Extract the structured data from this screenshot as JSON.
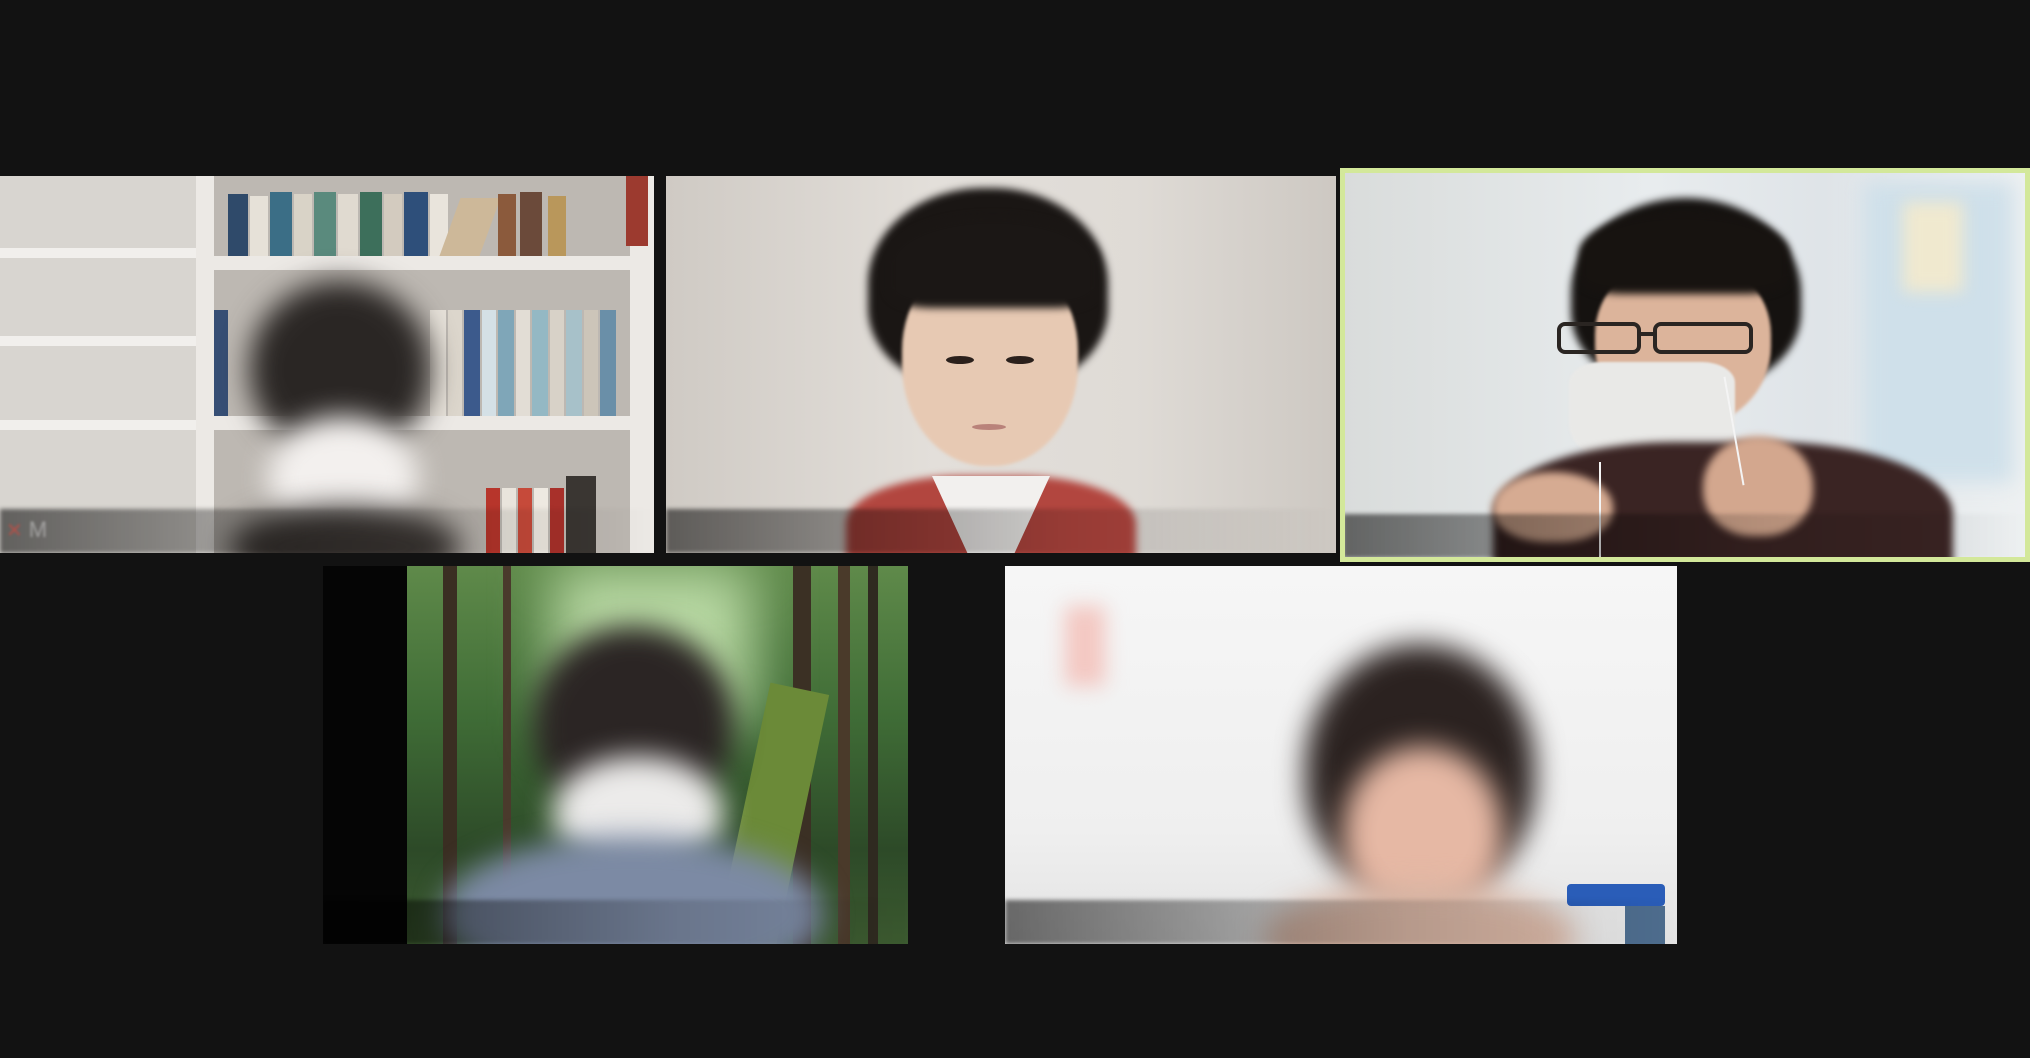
{
  "meeting": {
    "view": "gallery",
    "participant_count": 5,
    "active_speaker_index": 2
  },
  "participants": [
    {
      "name": "M",
      "muted": true,
      "video_on": true,
      "background": "bookshelf"
    },
    {
      "name": "",
      "muted": false,
      "video_on": true,
      "background": "plain-wall"
    },
    {
      "name": "",
      "muted": false,
      "video_on": true,
      "background": "office",
      "active_speaker": true
    },
    {
      "name": "",
      "muted": false,
      "video_on": true,
      "background": "forest"
    },
    {
      "name": "",
      "muted": false,
      "video_on": true,
      "background": "white-room"
    }
  ],
  "colors": {
    "stage_background": "#121212",
    "active_speaker_border": "#d3e89a",
    "mute_icon": "#e0453a"
  },
  "icons": {
    "muted": "mic-off-icon"
  }
}
